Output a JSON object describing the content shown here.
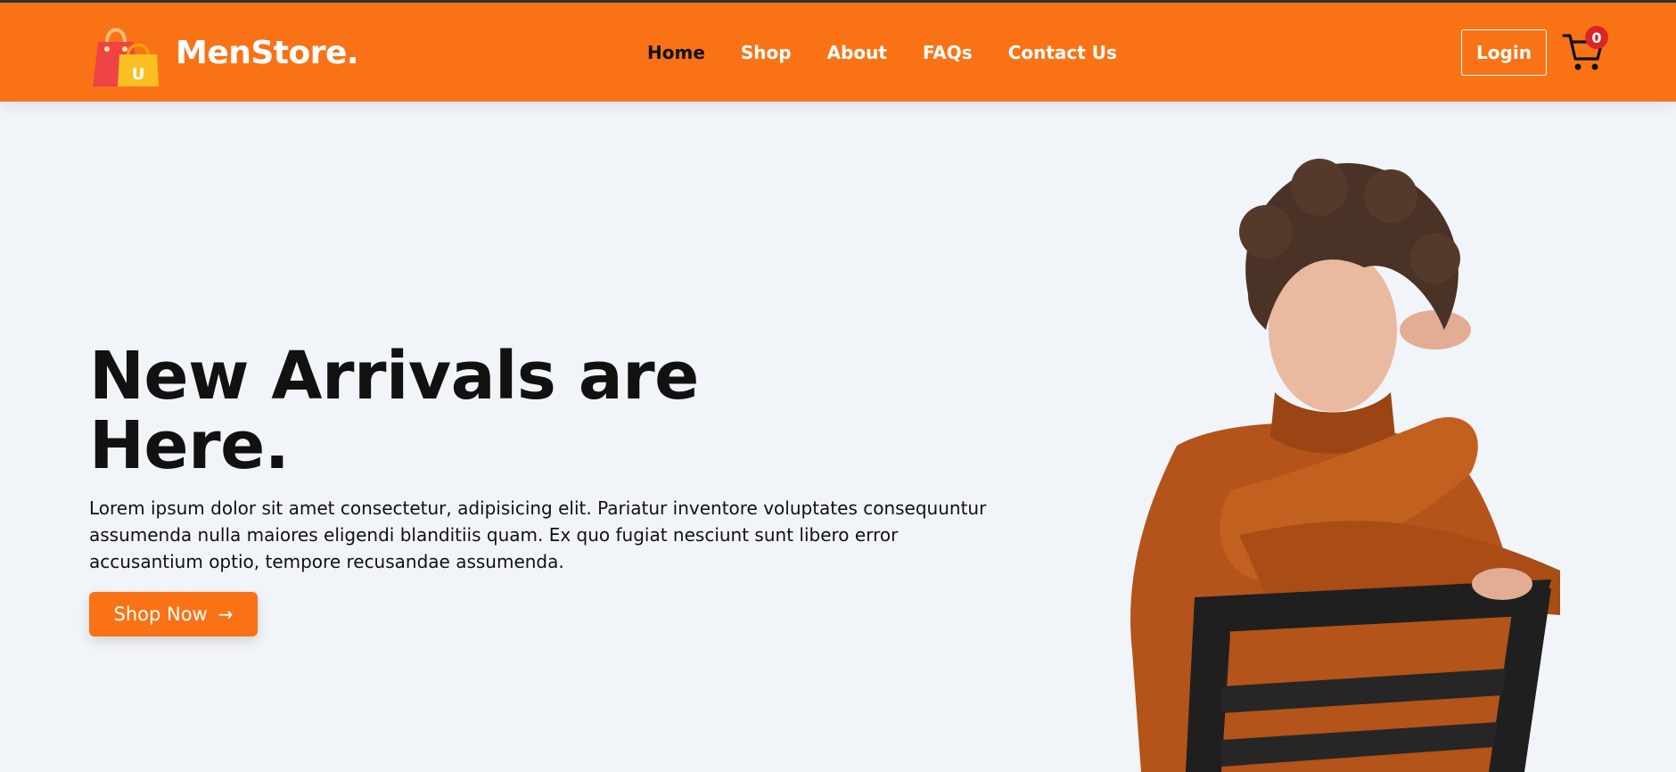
{
  "navbar": {
    "brand": "MenStore.",
    "links": [
      "Home",
      "Shop",
      "About",
      "FAQs",
      "Contact Us"
    ],
    "active_link": "Home",
    "login_label": "Login",
    "cart_count": "0"
  },
  "hero": {
    "title": "New Arrivals are Here.",
    "description": "Lorem ipsum dolor sit amet consectetur, adipisicing elit. Pariatur inventore voluptates consequuntur assumenda nulla maiores eligendi blanditiis quam. Ex quo fugiat nesciunt sunt libero error accusantium optio, tempore recusandae assumenda.",
    "cta_label": "Shop Now",
    "cta_icon": "arrow-right-icon",
    "image": "model-in-orange-sweater-on-chair"
  },
  "colors": {
    "accent": "#f97316",
    "background": "#f1f4f9",
    "badge": "#dc2626",
    "text": "#111111"
  },
  "icons": {
    "logo": "shopping-bags-icon",
    "cart": "shopping-cart-icon"
  }
}
